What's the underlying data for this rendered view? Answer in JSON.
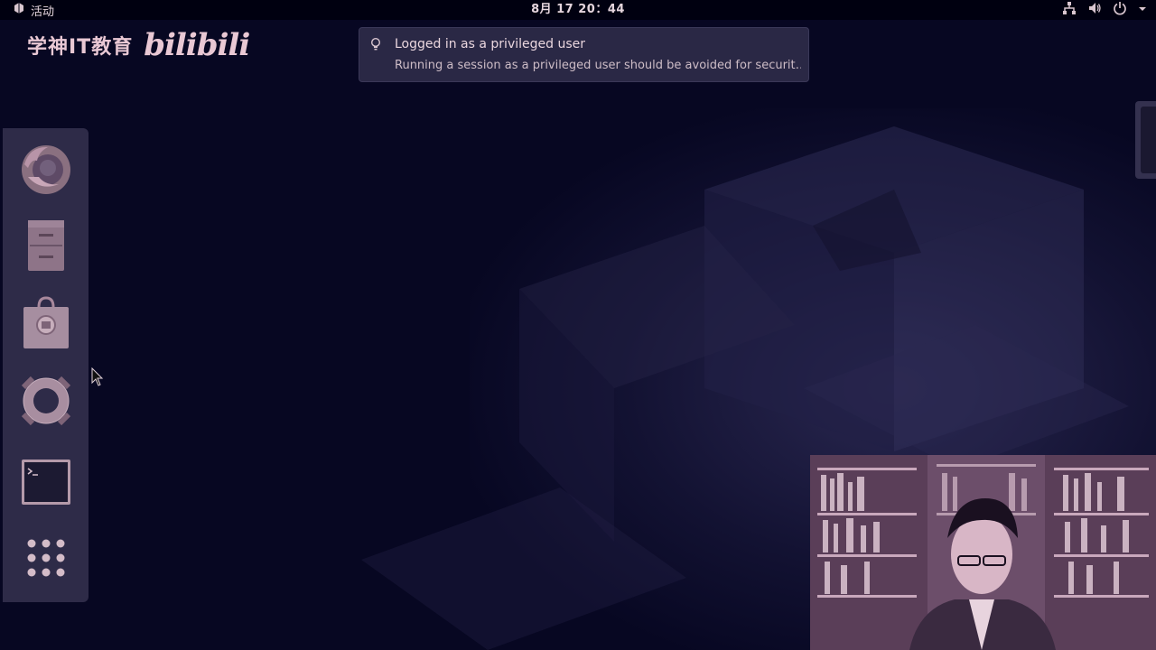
{
  "topbar": {
    "activities_label": "活动",
    "clock": "8月 17  20：44",
    "tray_icons": [
      "network-icon",
      "volume-icon",
      "power-icon",
      "chevron-down-icon"
    ]
  },
  "watermark": {
    "text": "学神IT教育",
    "logo": "bilibili"
  },
  "notification": {
    "icon": "lightbulb-icon",
    "title": "Logged in as a privileged user",
    "body": "Running a session as a privileged user should be avoided for securit…"
  },
  "dock": {
    "items": [
      {
        "name": "firefox",
        "icon": "firefox-icon"
      },
      {
        "name": "files",
        "icon": "file-cabinet-icon"
      },
      {
        "name": "software",
        "icon": "software-bag-icon"
      },
      {
        "name": "help",
        "icon": "lifebuoy-icon"
      },
      {
        "name": "terminal",
        "icon": "terminal-icon"
      },
      {
        "name": "show-applications",
        "icon": "app-grid-icon"
      }
    ]
  },
  "colors": {
    "background": "#070722",
    "topbar": "#000010",
    "dock": "#2e2b48",
    "notification": "#2a2845",
    "accent": "#e9c8d4"
  }
}
